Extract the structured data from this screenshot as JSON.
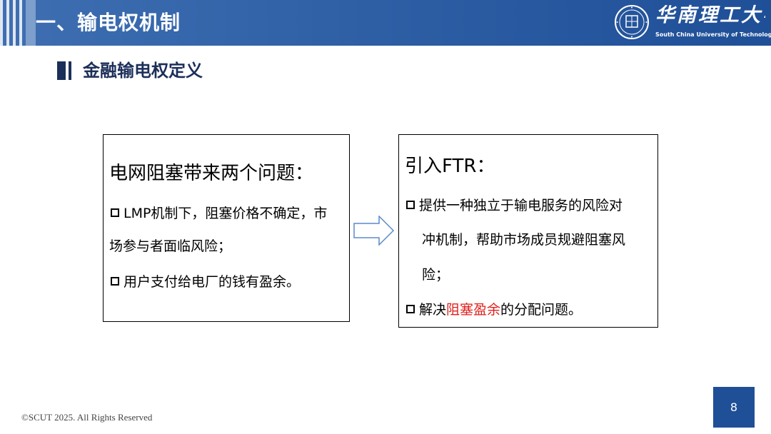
{
  "header": {
    "title": "一、输电权机制",
    "school_cn": "华南理工大学",
    "school_en": "South China University of Technology",
    "accent_color": "#2f5fa5"
  },
  "section": {
    "title": "金融输电权定义"
  },
  "left_box": {
    "title": "电网阻塞带来两个问题：",
    "line1": "LMP机制下，阻塞价格不确定，市",
    "line2": "场参与者面临风险；",
    "line3": "用户支付给电厂的钱有盈余。"
  },
  "right_box": {
    "title": "引入FTR：",
    "line1": "提供一种独立于输电服务的风险对",
    "line2": "冲机制，帮助市场成员规避阻塞风",
    "line3": "险；",
    "line4_pre": "解决",
    "line4_red": "阻塞盈余",
    "line4_post": "的分配问题。",
    "highlight_color": "#e0201c"
  },
  "footer": {
    "copyright": "©SCUT 2025. All Rights Reserved",
    "page_number": "8"
  }
}
